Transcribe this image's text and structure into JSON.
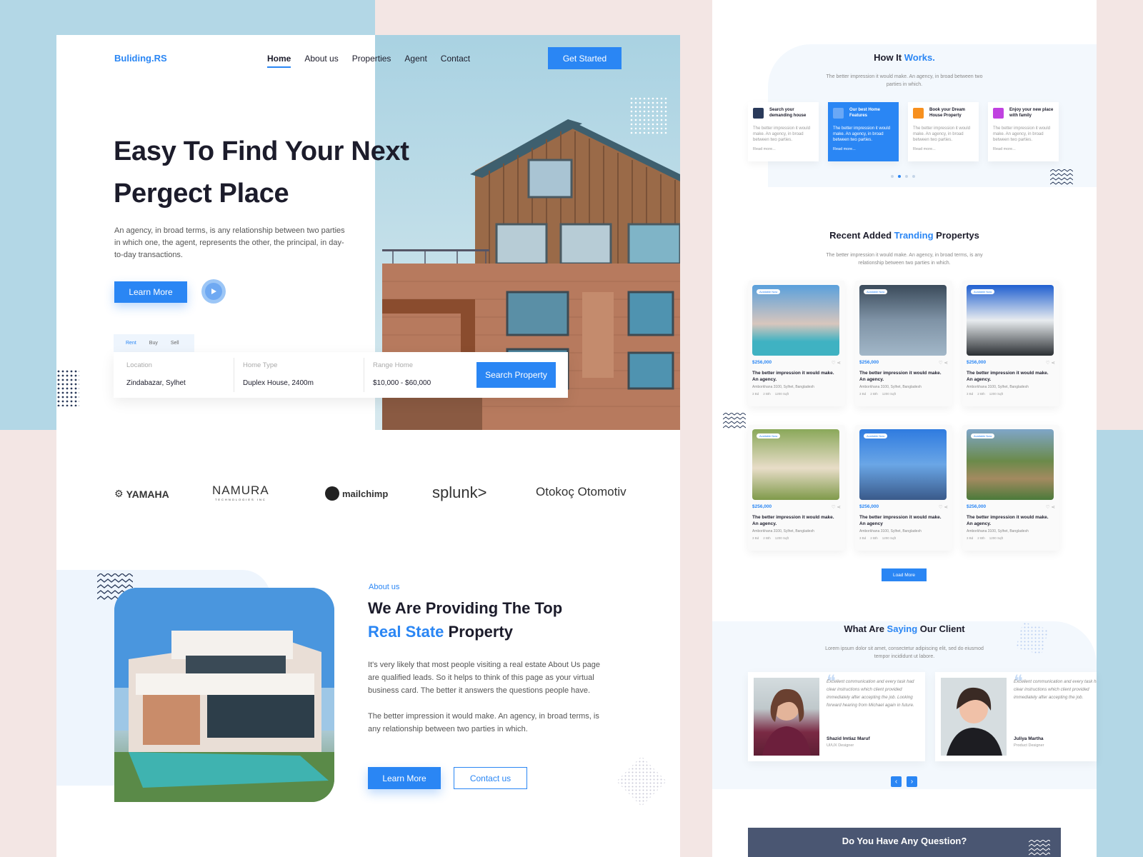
{
  "brand": "Buliding.RS",
  "nav": {
    "items": [
      "Home",
      "About us",
      "Properties",
      "Agent",
      "Contact"
    ],
    "active": "Home"
  },
  "header": {
    "cta": "Get Started"
  },
  "hero": {
    "title_line1": "Easy To Find Your Next",
    "title_line2": "Pergect Place",
    "text": "An agency, in broad terms, is any relationship between two parties in which one, the agent, represents the other, the principal, in day-to-day transactions.",
    "learn_more": "Learn More"
  },
  "search": {
    "tabs": [
      "Rent",
      "Buy",
      "Sell"
    ],
    "active_tab": "Rent",
    "location_label": "Location",
    "location_value": "Zindabazar, Sylhet",
    "type_label": "Home Type",
    "type_value": "Duplex House, 2400m",
    "range_label": "Range Home",
    "range_value": "$10,000 - $60,000",
    "button": "Search Property"
  },
  "brands": [
    "YAMAHA",
    "NAMURA",
    "mailchimp",
    "splunk>",
    "Otokoç Otomotiv"
  ],
  "brand_sub": {
    "namura": "TECHNOLOGIES INC"
  },
  "about": {
    "kicker": "About us",
    "title_line1": "We Are Providing The Top",
    "title_blue": "Real State",
    "title_end": "Property",
    "p1": "It's very likely that most people visiting a real estate About Us page are qualified leads. So it helps to think of this page as your virtual business card. The better it answers the questions people have.",
    "p2": "The better impression it would make. An agency, in broad terms, is any relationship between two parties in which.",
    "learn_more": "Learn More",
    "contact": "Contact us"
  },
  "how": {
    "title": "How It",
    "title_blue": "Works.",
    "sub": "The better impression it would make. An agency, in broad between two parties in which.",
    "steps": [
      {
        "title": "Search your demanding house",
        "desc": "The better impression it would make. An agency, in broad between two parties.",
        "link": "Read more..."
      },
      {
        "title": "Our best Home Features",
        "desc": "The better impression it would make. An agency, in broad between two parties.",
        "link": "Read more..."
      },
      {
        "title": "Book your Dream House Property",
        "desc": "The better impression it would make. An agency, in broad between two parties.",
        "link": "Read more..."
      },
      {
        "title": "Enjoy your new place with family",
        "desc": "The better impression it would make. An agency, in broad between two parties.",
        "link": "Read more..."
      }
    ],
    "dots": 4,
    "active_dot": 2
  },
  "recent": {
    "title_a": "Recent Added",
    "title_blue": "Tranding",
    "title_b": "Propertys",
    "sub": "The better impression it would make. An agency, in broad terms, is any relationship between two parties in which.",
    "load_more": "Load More",
    "badge": "Available Now",
    "cards": [
      {
        "price": "$256,000",
        "name": "The better impression it would make. An agency.",
        "address": "Amborkhana 3100, Sylhet, Bangladesh",
        "bed": "3 Bd",
        "bath": "2 Bth",
        "area": "1200 Sqft"
      },
      {
        "price": "$256,000",
        "name": "The better impression it would make. An agency.",
        "address": "Amborkhana 3100, Sylhet, Bangladesh",
        "bed": "3 Bd",
        "bath": "2 Bth",
        "area": "1200 Sqft"
      },
      {
        "price": "$256,000",
        "name": "The better impression it would make. An agency.",
        "address": "Amborkhana 3100, Sylhet, Bangladesh",
        "bed": "3 Bd",
        "bath": "2 Bth",
        "area": "1200 Sqft"
      },
      {
        "price": "$256,000",
        "name": "The better impression it would make. An agency.",
        "address": "Amborkhana 3100, Sylhet, Bangladesh",
        "bed": "3 Bd",
        "bath": "2 Bth",
        "area": "1200 Sqft"
      },
      {
        "price": "$256,000",
        "name": "The better impression it would make. An agency",
        "address": "Amborkhana 3100, Sylhet, Bangladesh",
        "bed": "3 Bd",
        "bath": "2 Bth",
        "area": "1200 Sqft"
      },
      {
        "price": "$256,000",
        "name": "The better impression it would make. An agency.",
        "address": "Amborkhana 3100, Sylhet, Bangladesh",
        "bed": "3 Bd",
        "bath": "2 Bth",
        "area": "1200 Sqft"
      }
    ]
  },
  "clients": {
    "title_a": "What Are",
    "title_blue": "Saying",
    "title_b": "Our Client",
    "sub": "Lorem ipsum dolor sit amet, consectetur adipiscing elit, sed do eiusmod tempor incididunt ut labore.",
    "items": [
      {
        "quote": "Excellent communication and every task had clear instructions which client provided immediately after accepting the job. Looking forward hearing from Michael again in future.",
        "name": "Shazid Imtiaz Maruf",
        "role": "UI/UX Designer"
      },
      {
        "quote": "Excellent communication and every task had clear instructions which client provided immediately after accepting the job.",
        "name": "Juliya Martha",
        "role": "Product Designer"
      }
    ]
  },
  "faq": {
    "title": "Do You Have Any Question?"
  },
  "colors": {
    "accent": "#2a86f4",
    "sky": "#b3d7e6",
    "blush": "#f3e6e4",
    "dark": "#1c1c2b"
  }
}
